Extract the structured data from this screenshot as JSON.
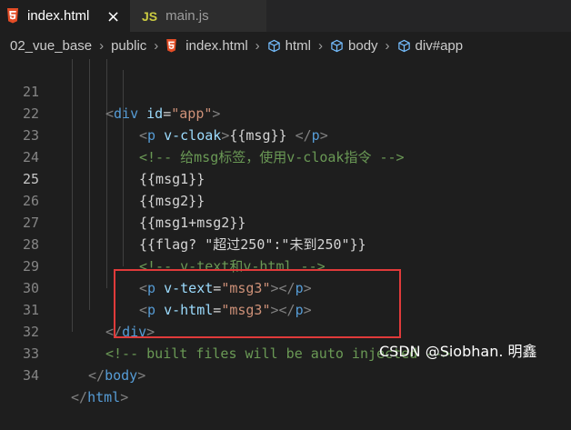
{
  "tabs": [
    {
      "label": "index.html",
      "icon": "html5-icon",
      "active": true,
      "close": "×"
    },
    {
      "label": "main.js",
      "icon": "js-icon",
      "icon_text": "JS",
      "active": false
    }
  ],
  "breadcrumb": {
    "items": [
      "02_vue_base",
      "public",
      "index.html",
      "html",
      "body",
      "div#app"
    ],
    "separator": "›"
  },
  "editor": {
    "current_line": 25,
    "lines": [
      {
        "n": "21"
      },
      {
        "n": "22"
      },
      {
        "n": "23"
      },
      {
        "n": "24"
      },
      {
        "n": "25"
      },
      {
        "n": "26"
      },
      {
        "n": "27"
      },
      {
        "n": "28"
      },
      {
        "n": "29"
      },
      {
        "n": "30"
      },
      {
        "n": "31"
      },
      {
        "n": "32"
      },
      {
        "n": "33"
      },
      {
        "n": "34"
      }
    ],
    "code": {
      "l21": {
        "lt": "<",
        "tag": "div",
        "attr": "id",
        "eq": "=",
        "val": "\"app\"",
        "gt": ">"
      },
      "l22": {
        "lt": "<",
        "tag": "p",
        "attr": "v-cloak",
        "gt": ">",
        "text": "{{msg}} ",
        "close_lt": "</",
        "close_tag": "p",
        "close_gt": ">"
      },
      "l23": {
        "comment": "<!-- 给msg标签，使用v-cloak指令 -->"
      },
      "l24": {
        "text": "{{msg1}}"
      },
      "l25": {
        "text": "{{msg2}}"
      },
      "l26": {
        "text": "{{msg1+msg2}}"
      },
      "l27": {
        "text": "{{flag? \"超过250\":\"未到250\"}}"
      },
      "l28": {
        "comment": "<!-- v-text和v-html -->"
      },
      "l29": {
        "lt": "<",
        "tag": "p",
        "attr": "v-text",
        "eq": "=",
        "val": "\"msg3\"",
        "gt": ">",
        "close_lt": "</",
        "close_tag": "p",
        "close_gt": ">"
      },
      "l30": {
        "lt": "<",
        "tag": "p",
        "attr": "v-html",
        "eq": "=",
        "val": "\"msg3\"",
        "gt": ">",
        "close_lt": "</",
        "close_tag": "p",
        "close_gt": ">"
      },
      "l31": {
        "lt": "</",
        "tag": "div",
        "gt": ">"
      },
      "l32": {
        "comment": "<!-- built files will be auto injected -->"
      },
      "l33": {
        "lt": "</",
        "tag": "body",
        "gt": ">"
      },
      "l34": {
        "lt": "</",
        "tag": "html",
        "gt": ">"
      }
    }
  },
  "watermark": "CSDN @Siobhan. 明鑫",
  "colors": {
    "background": "#1e1e1e",
    "tag": "#569cd6",
    "attribute": "#9cdcfe",
    "string": "#ce9178",
    "comment": "#6a9955",
    "text": "#d4d4d4",
    "highlight_box": "#e03a3a",
    "html_icon": "#e44d26",
    "js_icon": "#cbcb41"
  }
}
